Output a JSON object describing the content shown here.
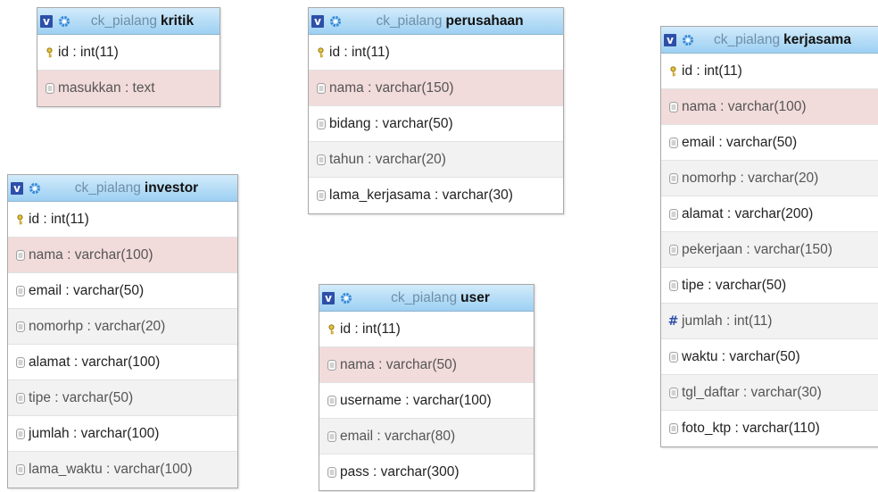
{
  "tables": [
    {
      "name": "kritik",
      "db": "ck_pialang",
      "columns": [
        {
          "text": "id : int(11)",
          "icon": "key"
        },
        {
          "text": "masukkan : text",
          "icon": "column"
        }
      ]
    },
    {
      "name": "perusahaan",
      "db": "ck_pialang",
      "columns": [
        {
          "text": "id : int(11)",
          "icon": "key"
        },
        {
          "text": "nama : varchar(150)",
          "icon": "column"
        },
        {
          "text": "bidang : varchar(50)",
          "icon": "column"
        },
        {
          "text": "tahun : varchar(20)",
          "icon": "column"
        },
        {
          "text": "lama_kerjasama : varchar(30)",
          "icon": "column"
        }
      ]
    },
    {
      "name": "kerjasama",
      "db": "ck_pialang",
      "columns": [
        {
          "text": "id : int(11)",
          "icon": "key"
        },
        {
          "text": "nama : varchar(100)",
          "icon": "column"
        },
        {
          "text": "email : varchar(50)",
          "icon": "column"
        },
        {
          "text": "nomorhp : varchar(20)",
          "icon": "column"
        },
        {
          "text": "alamat : varchar(200)",
          "icon": "column"
        },
        {
          "text": "pekerjaan : varchar(150)",
          "icon": "column"
        },
        {
          "text": "tipe : varchar(50)",
          "icon": "column"
        },
        {
          "text": "jumlah : int(11)",
          "icon": "numeric"
        },
        {
          "text": "waktu : varchar(50)",
          "icon": "column"
        },
        {
          "text": "tgl_daftar : varchar(30)",
          "icon": "column"
        },
        {
          "text": "foto_ktp : varchar(110)",
          "icon": "column"
        }
      ]
    },
    {
      "name": "investor",
      "db": "ck_pialang",
      "columns": [
        {
          "text": "id : int(11)",
          "icon": "key"
        },
        {
          "text": "nama : varchar(100)",
          "icon": "column"
        },
        {
          "text": "email : varchar(50)",
          "icon": "column"
        },
        {
          "text": "nomorhp : varchar(20)",
          "icon": "column"
        },
        {
          "text": "alamat : varchar(100)",
          "icon": "column"
        },
        {
          "text": "tipe : varchar(50)",
          "icon": "column"
        },
        {
          "text": "jumlah : varchar(100)",
          "icon": "column"
        },
        {
          "text": "lama_waktu : varchar(100)",
          "icon": "column"
        }
      ]
    },
    {
      "name": "user",
      "db": "ck_pialang",
      "columns": [
        {
          "text": "id : int(11)",
          "icon": "key"
        },
        {
          "text": "nama : varchar(50)",
          "icon": "column"
        },
        {
          "text": "username : varchar(100)",
          "icon": "column"
        },
        {
          "text": "email : varchar(80)",
          "icon": "column"
        },
        {
          "text": "pass : varchar(300)",
          "icon": "column"
        }
      ]
    }
  ],
  "toggle_label": "v",
  "colors": {
    "header_top": "#d3ebfb",
    "header_bottom": "#9dd0f3",
    "db_text": "#6f8fa8",
    "highlight_row": "#f2dbdb",
    "alt_row": "#f2f2f2",
    "toggle_bg": "#2d4fa8"
  }
}
